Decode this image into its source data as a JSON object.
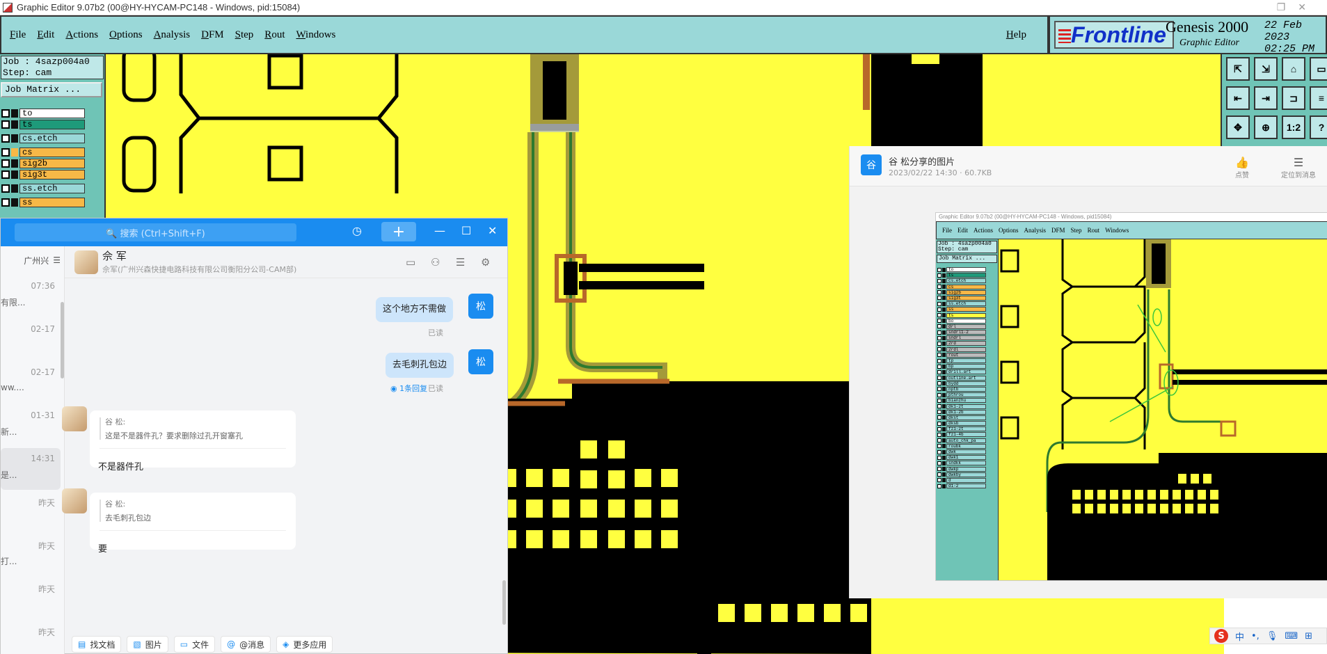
{
  "window": {
    "title": "Graphic Editor 9.07b2 (00@HY-HYCAM-PC148 - Windows, pid:15084)",
    "restore_glyph": "❐",
    "close_glyph": "✕"
  },
  "menu": {
    "items": [
      "File",
      "Edit",
      "Actions",
      "Options",
      "Analysis",
      "DFM",
      "Step",
      "Rout",
      "Windows"
    ],
    "help": "Help"
  },
  "brand": {
    "logo": "Frontline",
    "product": "Genesis 2000",
    "subtitle": "Graphic Editor",
    "date": "22 Feb 2023",
    "time": "02:25 PM"
  },
  "job": {
    "job_label": "Job : 4sazp004a0",
    "step_label": "Step: cam",
    "matrix_button": "Job Matrix ..."
  },
  "layers": [
    {
      "name": "to",
      "color": "#ffffff"
    },
    {
      "name": "ts",
      "color": "#1e9a7a"
    },
    {
      "name": "cs.etch",
      "color": "#9ad8d8"
    },
    {
      "name": "cs",
      "color": "#f7b847"
    },
    {
      "name": "sig2b",
      "color": "#f7b847"
    },
    {
      "name": "sig3t",
      "color": "#f7b847"
    },
    {
      "name": "ss.etch",
      "color": "#9ad8d8"
    },
    {
      "name": "ss",
      "color": "#f7b847"
    }
  ],
  "toolbox": {
    "labels": [
      "1:2",
      "?"
    ]
  },
  "chat": {
    "search_placeholder": "🔍 搜索 (Ctrl+Shift+F)",
    "list_header": "广州兴",
    "conversations": [
      {
        "time": "07:36",
        "preview": "有限..."
      },
      {
        "time": "02-17",
        "preview": ""
      },
      {
        "time": "02-17",
        "preview": "ww...."
      },
      {
        "time": "01-31",
        "preview": "新..."
      },
      {
        "time": "14:31",
        "preview": "是..."
      },
      {
        "time": "昨天",
        "preview": ""
      },
      {
        "time": "昨天",
        "preview": "打..."
      },
      {
        "time": "昨天",
        "preview": ""
      },
      {
        "time": "昨天",
        "preview": ""
      }
    ],
    "contact": {
      "name": "佘 军",
      "org": "佘军(广州兴森快捷电路科技有限公司衡阳分公司-CAM部)"
    },
    "messages": [
      {
        "text": "这个地方不需做",
        "status": "已读",
        "avatar": "松"
      },
      {
        "text": "去毛刺孔包边",
        "status": "已读",
        "reply": "1条回复",
        "avatar": "松"
      }
    ],
    "replies": [
      {
        "quote_name": "谷 松:",
        "quote": "这是不是器件孔？要求删除过孔开窗塞孔",
        "text": "不是器件孔"
      },
      {
        "quote_name": "谷 松:",
        "quote": "去毛刺孔包边",
        "text": "要"
      }
    ],
    "toolbar": [
      "找文档",
      "图片",
      "文件",
      "@消息",
      "更多应用"
    ]
  },
  "viewer": {
    "avatar": "谷",
    "title": "谷 松分享的图片",
    "meta": "2023/02/22 14:30 · 60.7KB",
    "like": "点赞",
    "locate": "定位到消息",
    "thumb_title": "Graphic Editor 9.07b2 (00@HY-HYCAM-PC148 - Windows, pid15084)",
    "thumb_menu": [
      "File",
      "Edit",
      "Actions",
      "Options",
      "Analysis",
      "DFM",
      "Step",
      "Rout",
      "Windows"
    ],
    "thumb_job": "Job : 4sazp004a0",
    "thumb_step": "Step: cam",
    "thumb_matrix": "Job Matrix ...",
    "thumb_layers": [
      "to",
      "ts",
      "cs.etch",
      "cs",
      "sig2b",
      "sig3t",
      "ss.etch",
      "ss",
      "ts",
      "bo",
      "drl",
      "sndrl1-2",
      "sndrl",
      "2rd",
      "2rdl",
      "rout",
      "tp",
      "bp",
      "drill.art",
      "outline.art",
      "bydd",
      "nptb",
      "pthrou",
      "bianzhu",
      "dk1-2t",
      "dk1-2b",
      "dkst",
      "dksb",
      "fz1-2t",
      "fz1-4b",
      "auto_chk_pa",
      "roubk",
      "dwk",
      "dwk1",
      "sndkk",
      "dwkp",
      "dwkby",
      "d",
      "d1-2"
    ]
  },
  "tray": {
    "ime": "中"
  }
}
